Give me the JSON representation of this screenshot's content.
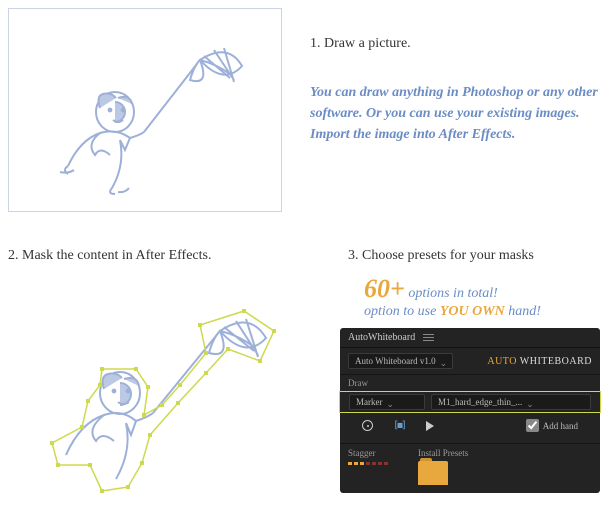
{
  "step1": "1. Draw a picture.",
  "note": "You can draw anything in Photoshop or any other software. Or you can use your existing images. Import the image into After Effects.",
  "step2": "2. Mask the content in After Effects.",
  "step3": "3. Choose presets for your masks",
  "tagline1_count": "60+",
  "tagline1_rest": " options in total!",
  "tagline2_a": "option to use ",
  "tagline2_b": "YOU OWN",
  "tagline2_c": " hand!",
  "panel": {
    "title": "AutoWhiteboard",
    "version": "Auto Whiteboard v1.0",
    "logo_a": "AUTO ",
    "logo_b": "WHITEBOARD",
    "draw_label": "Draw",
    "brush": "Marker",
    "preset": "M1_hard_edge_thin_...",
    "addhand": "Add hand",
    "stagger": "Stagger",
    "install": "Install Presets"
  }
}
